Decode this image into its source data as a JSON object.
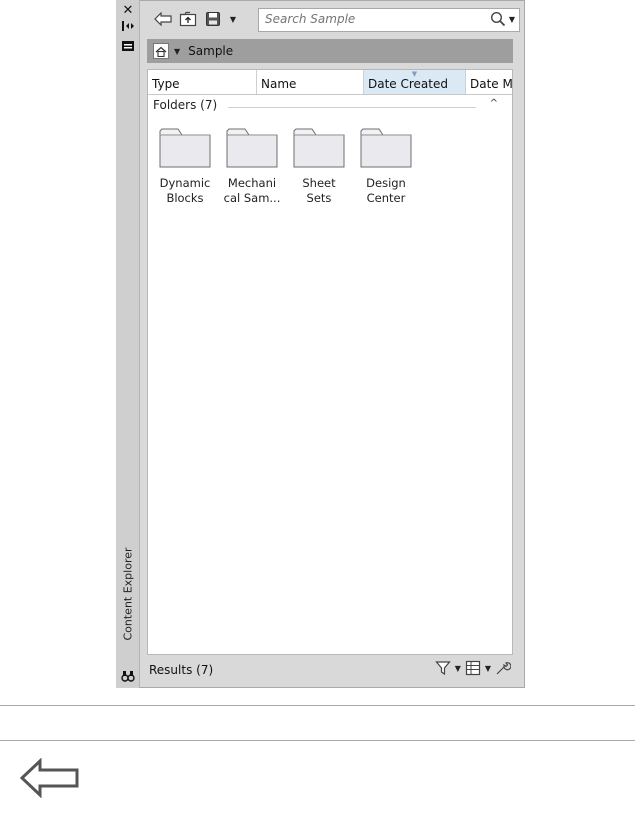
{
  "window": {
    "title": "Content Explorer"
  },
  "toolbar": {
    "back_icon": "back-arrow-icon",
    "up_icon": "up-folder-icon",
    "save_icon": "save-icon",
    "search_placeholder": "Search Sample",
    "search_icon": "magnifier-icon"
  },
  "breadcrumb": {
    "home_icon": "home-icon",
    "current": "Sample"
  },
  "columns": [
    "Type",
    "Name",
    "Date Created",
    "Date M"
  ],
  "sorted_column": "Date Created",
  "group": {
    "label": "Folders (7)"
  },
  "folders": [
    {
      "line1": "Dynamic",
      "line2": "Blocks"
    },
    {
      "line1": "Mechani",
      "line2": "cal Sam..."
    },
    {
      "line1": "Sheet",
      "line2": "Sets"
    },
    {
      "line1": "Design",
      "line2": "Center"
    }
  ],
  "status": {
    "results": "Results (7)",
    "filter_icon": "filter-icon",
    "view_icon": "view-options-icon",
    "settings_icon": "wrench-icon"
  },
  "colors": {
    "frame": "#d9d9d9",
    "breadcrumb": "#9e9e9e",
    "sorted_column": "#dbe9f5"
  }
}
